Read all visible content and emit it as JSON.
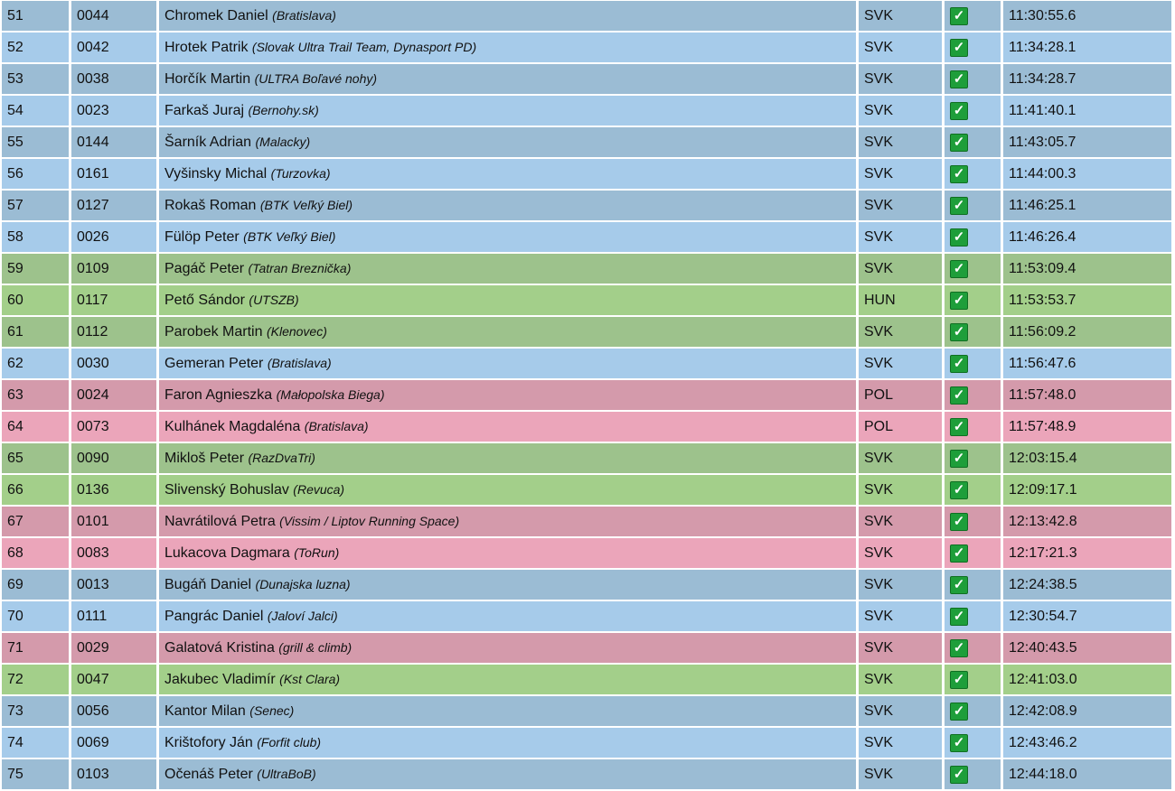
{
  "icons": {
    "finished": "check-icon"
  },
  "colors": {
    "category_a_dark": "#9bbcd4",
    "category_a_light": "#a6cbea",
    "category_b_dark": "#9dc28c",
    "category_b_light": "#a3cf8a",
    "category_c_dark": "#d49aab",
    "category_c_light": "#eba5ba",
    "check_green": "#1e9e3a"
  },
  "rows": [
    {
      "rank": "51",
      "bib": "0044",
      "name": "Chromek Daniel",
      "club": "(Bratislava)",
      "nat": "SVK",
      "time": "11:30:55.6",
      "cat": "a"
    },
    {
      "rank": "52",
      "bib": "0042",
      "name": "Hrotek Patrik",
      "club": "(Slovak Ultra Trail Team, Dynasport PD)",
      "nat": "SVK",
      "time": "11:34:28.1",
      "cat": "a"
    },
    {
      "rank": "53",
      "bib": "0038",
      "name": "Horčík Martin",
      "club": "(ULTRA Boľavé nohy)",
      "nat": "SVK",
      "time": "11:34:28.7",
      "cat": "a"
    },
    {
      "rank": "54",
      "bib": "0023",
      "name": "Farkaš Juraj",
      "club": "(Bernohy.sk)",
      "nat": "SVK",
      "time": "11:41:40.1",
      "cat": "a"
    },
    {
      "rank": "55",
      "bib": "0144",
      "name": "Šarník Adrian",
      "club": "(Malacky)",
      "nat": "SVK",
      "time": "11:43:05.7",
      "cat": "a"
    },
    {
      "rank": "56",
      "bib": "0161",
      "name": "Vyšinsky Michal",
      "club": "(Turzovka)",
      "nat": "SVK",
      "time": "11:44:00.3",
      "cat": "a"
    },
    {
      "rank": "57",
      "bib": "0127",
      "name": "Rokaš Roman",
      "club": "(BTK Veľký Biel)",
      "nat": "SVK",
      "time": "11:46:25.1",
      "cat": "a"
    },
    {
      "rank": "58",
      "bib": "0026",
      "name": "Fülöp Peter",
      "club": "(BTK Veľký Biel)",
      "nat": "SVK",
      "time": "11:46:26.4",
      "cat": "a"
    },
    {
      "rank": "59",
      "bib": "0109",
      "name": "Pagáč Peter",
      "club": "(Tatran Breznička)",
      "nat": "SVK",
      "time": "11:53:09.4",
      "cat": "b"
    },
    {
      "rank": "60",
      "bib": "0117",
      "name": "Pető Sándor",
      "club": "(UTSZB)",
      "nat": "HUN",
      "time": "11:53:53.7",
      "cat": "b"
    },
    {
      "rank": "61",
      "bib": "0112",
      "name": "Parobek Martin",
      "club": "(Klenovec)",
      "nat": "SVK",
      "time": "11:56:09.2",
      "cat": "b"
    },
    {
      "rank": "62",
      "bib": "0030",
      "name": "Gemeran Peter",
      "club": "(Bratislava)",
      "nat": "SVK",
      "time": "11:56:47.6",
      "cat": "a"
    },
    {
      "rank": "63",
      "bib": "0024",
      "name": "Faron Agnieszka",
      "club": "(Małopolska Biega)",
      "nat": "POL",
      "time": "11:57:48.0",
      "cat": "c"
    },
    {
      "rank": "64",
      "bib": "0073",
      "name": "Kulhánek Magdaléna",
      "club": "(Bratislava)",
      "nat": "POL",
      "time": "11:57:48.9",
      "cat": "c"
    },
    {
      "rank": "65",
      "bib": "0090",
      "name": "Mikloš Peter",
      "club": "(RazDvaTri)",
      "nat": "SVK",
      "time": "12:03:15.4",
      "cat": "b"
    },
    {
      "rank": "66",
      "bib": "0136",
      "name": "Slivenský Bohuslav",
      "club": "(Revuca)",
      "nat": "SVK",
      "time": "12:09:17.1",
      "cat": "b"
    },
    {
      "rank": "67",
      "bib": "0101",
      "name": "Navrátilová Petra",
      "club": "(Vissim / Liptov Running Space)",
      "nat": "SVK",
      "time": "12:13:42.8",
      "cat": "c"
    },
    {
      "rank": "68",
      "bib": "0083",
      "name": "Lukacova Dagmara",
      "club": "(ToRun)",
      "nat": "SVK",
      "time": "12:17:21.3",
      "cat": "c"
    },
    {
      "rank": "69",
      "bib": "0013",
      "name": "Bugáň Daniel",
      "club": "(Dunajska luzna)",
      "nat": "SVK",
      "time": "12:24:38.5",
      "cat": "a"
    },
    {
      "rank": "70",
      "bib": "0111",
      "name": "Pangrác Daniel",
      "club": "(Jaloví Jalci)",
      "nat": "SVK",
      "time": "12:30:54.7",
      "cat": "a"
    },
    {
      "rank": "71",
      "bib": "0029",
      "name": "Galatová Kristina",
      "club": "(grill & climb)",
      "nat": "SVK",
      "time": "12:40:43.5",
      "cat": "c"
    },
    {
      "rank": "72",
      "bib": "0047",
      "name": "Jakubec Vladimír",
      "club": "(Kst Clara)",
      "nat": "SVK",
      "time": "12:41:03.0",
      "cat": "b"
    },
    {
      "rank": "73",
      "bib": "0056",
      "name": "Kantor Milan",
      "club": "(Senec)",
      "nat": "SVK",
      "time": "12:42:08.9",
      "cat": "a"
    },
    {
      "rank": "74",
      "bib": "0069",
      "name": "Krištofory Ján",
      "club": "(Forfit club)",
      "nat": "SVK",
      "time": "12:43:46.2",
      "cat": "a"
    },
    {
      "rank": "75",
      "bib": "0103",
      "name": "Očenáš Peter",
      "club": "(UltraBoB)",
      "nat": "SVK",
      "time": "12:44:18.0",
      "cat": "a"
    }
  ]
}
